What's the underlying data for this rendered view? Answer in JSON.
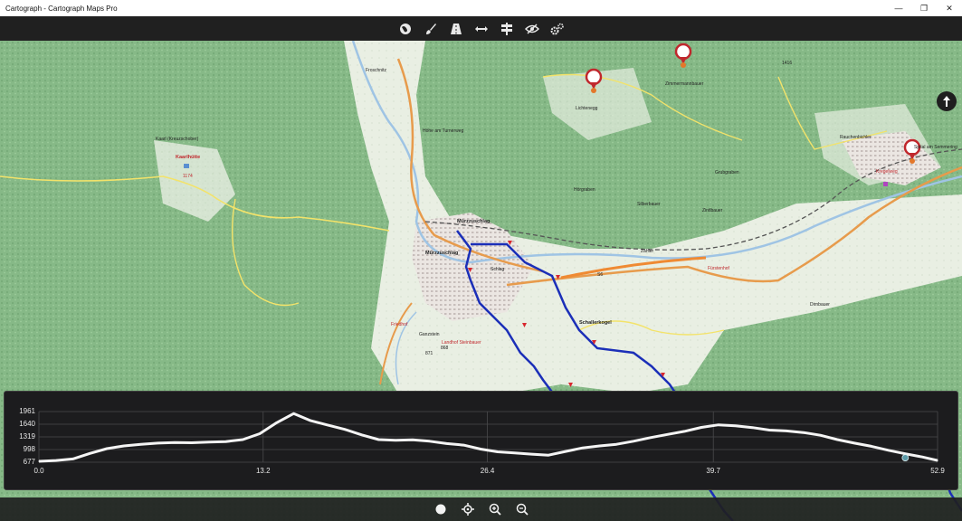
{
  "window": {
    "title": "Cartograph - Cartograph Maps Pro",
    "controls": [
      "minimize",
      "maximize",
      "close"
    ]
  },
  "toolbar": {
    "buttons": [
      {
        "icon": "globe-icon",
        "label": "Map"
      },
      {
        "icon": "brush-icon",
        "label": "Draw"
      },
      {
        "icon": "road-icon",
        "label": "Route"
      },
      {
        "icon": "measure-icon",
        "label": "Measure"
      },
      {
        "icon": "signpost-icon",
        "label": "Waypoints"
      },
      {
        "icon": "visibility-icon",
        "label": "Layers"
      },
      {
        "icon": "settings-icon",
        "label": "Settings"
      }
    ]
  },
  "map": {
    "labels": {
      "town": "Mürzzuschlag",
      "town2": "Mürzzuschlag",
      "kaarl": "Kaarl (Kreuzschober)",
      "kaarlhuette": "Kaarlhütte",
      "kaarl_alt": "1174",
      "gansstein": "Ganzstein",
      "ganz_alt1": "868",
      "ganz_alt2": "871",
      "schaller": "Schallerkogel",
      "peak_1416": "1416",
      "spital": "Spital am Semmering",
      "kregel": "Kregelweg",
      "hoehe": "Höhe am Turnerweg",
      "froschnitz": "Froschnitz",
      "lichtenegg": "Lichtenegg",
      "zimmermann": "Zimmermannbauer",
      "rauchenbichl": "Rauchenbichler",
      "grubgraben": "Grubgraben",
      "dirnbauer": "Dirnbauer",
      "fuerstenhof": "Fürstenhof",
      "schlag": "Schlag",
      "friedhof": "Friedhof",
      "landhof": "Landhof Steinbauer",
      "hoergraben": "Hörgraben",
      "silberbauer": "Silberbauer",
      "zintlbauer": "Zintlbauer",
      "s6": "S6",
      "zahler": "Zahler"
    }
  },
  "elevation_panel": {
    "current_position_color": "#5b9aa8"
  },
  "chart_data": {
    "type": "line",
    "title": "",
    "xlabel": "",
    "ylabel": "",
    "x_ticks": [
      "0.0",
      "13.2",
      "26.4",
      "39.7",
      "52.9"
    ],
    "y_ticks": [
      "1961",
      "1640",
      "1319",
      "998",
      "677"
    ],
    "xlim": [
      0,
      52.9
    ],
    "ylim": [
      677,
      1961
    ],
    "grid": true,
    "series": [
      {
        "x": [
          0,
          1,
          2,
          3,
          4,
          5,
          6,
          7,
          8,
          9,
          10,
          11,
          12,
          13,
          14,
          15,
          16,
          17,
          18,
          19,
          20,
          21,
          22,
          23,
          24,
          25,
          26,
          27,
          28,
          29,
          30,
          31,
          32,
          33,
          34,
          35,
          36,
          37,
          38,
          39,
          40,
          41,
          42,
          43,
          44,
          45,
          46,
          47,
          48,
          49,
          50,
          51,
          52,
          52.9
        ],
        "y": [
          700,
          720,
          760,
          900,
          1020,
          1090,
          1130,
          1160,
          1175,
          1170,
          1185,
          1200,
          1250,
          1400,
          1680,
          1910,
          1730,
          1620,
          1510,
          1370,
          1250,
          1235,
          1245,
          1210,
          1150,
          1110,
          1010,
          940,
          910,
          880,
          855,
          950,
          1040,
          1090,
          1130,
          1210,
          1300,
          1380,
          1460,
          1560,
          1625,
          1600,
          1555,
          1490,
          1470,
          1430,
          1360,
          1250,
          1160,
          1080,
          980,
          890,
          810,
          720
        ]
      }
    ],
    "marker": {
      "x": 51.0,
      "y": 790
    }
  },
  "bottombar": {
    "buttons": [
      {
        "icon": "record-icon",
        "label": "Record"
      },
      {
        "icon": "locate-icon",
        "label": "Locate"
      },
      {
        "icon": "zoom-in-icon",
        "label": "Zoom in"
      },
      {
        "icon": "zoom-out-icon",
        "label": "Zoom out"
      }
    ]
  }
}
